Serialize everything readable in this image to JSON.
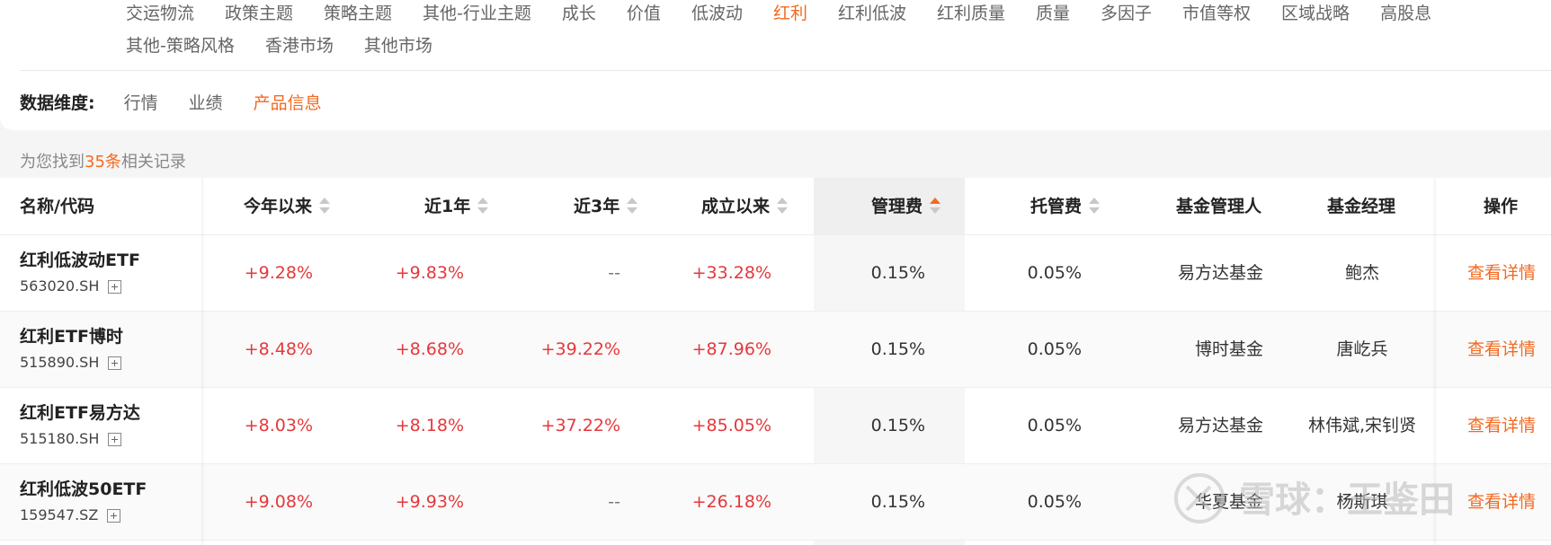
{
  "categories_row1": [
    "交运物流",
    "政策主题",
    "策略主题",
    "其他-行业主题",
    "成长",
    "价值",
    "低波动",
    "红利",
    "红利低波",
    "红利质量",
    "质量",
    "多因子",
    "市值等权",
    "区域战略",
    "高股息"
  ],
  "categories_row2": [
    "其他-策略风格",
    "香港市场",
    "其他市场"
  ],
  "active_category": "红利",
  "dimension": {
    "label": "数据维度:",
    "options": [
      "行情",
      "业绩",
      "产品信息"
    ],
    "active": "产品信息"
  },
  "result": {
    "prefix": "为您找到",
    "count": "35条",
    "suffix": "相关记录"
  },
  "table": {
    "headers": {
      "name": "名称/代码",
      "ytd": "今年以来",
      "y1": "近1年",
      "y3": "近3年",
      "since": "成立以来",
      "mgmt_fee": "管理费",
      "custody_fee": "托管费",
      "manager": "基金管理人",
      "pm": "基金经理",
      "action": "操作"
    },
    "rows": [
      {
        "name": "红利低波动ETF",
        "code": "563020.SH",
        "ytd": "+9.28%",
        "y1": "+9.83%",
        "y3": "--",
        "since": "+33.28%",
        "mgmt_fee": "0.15%",
        "custody_fee": "0.05%",
        "manager": "易方达基金",
        "pm": "鲍杰",
        "action": "查看详情"
      },
      {
        "name": "红利ETF博时",
        "code": "515890.SH",
        "ytd": "+8.48%",
        "y1": "+8.68%",
        "y3": "+39.22%",
        "since": "+87.96%",
        "mgmt_fee": "0.15%",
        "custody_fee": "0.05%",
        "manager": "博时基金",
        "pm": "唐屹兵",
        "action": "查看详情"
      },
      {
        "name": "红利ETF易方达",
        "code": "515180.SH",
        "ytd": "+8.03%",
        "y1": "+8.18%",
        "y3": "+37.22%",
        "since": "+85.05%",
        "mgmt_fee": "0.15%",
        "custody_fee": "0.05%",
        "manager": "易方达基金",
        "pm": "林伟斌,宋钊贤",
        "action": "查看详情"
      },
      {
        "name": "红利低波50ETF",
        "code": "159547.SZ",
        "ytd": "+9.08%",
        "y1": "+9.93%",
        "y3": "--",
        "since": "+26.18%",
        "mgmt_fee": "0.15%",
        "custody_fee": "0.05%",
        "manager": "华夏基金",
        "pm": "杨斯琪",
        "action": "查看详情"
      }
    ]
  },
  "watermark": {
    "text": "雪球：王鉴田"
  },
  "colors": {
    "accent": "#f26a21",
    "up": "#e5383b",
    "sort_col_bg": "#f6f6f6"
  }
}
